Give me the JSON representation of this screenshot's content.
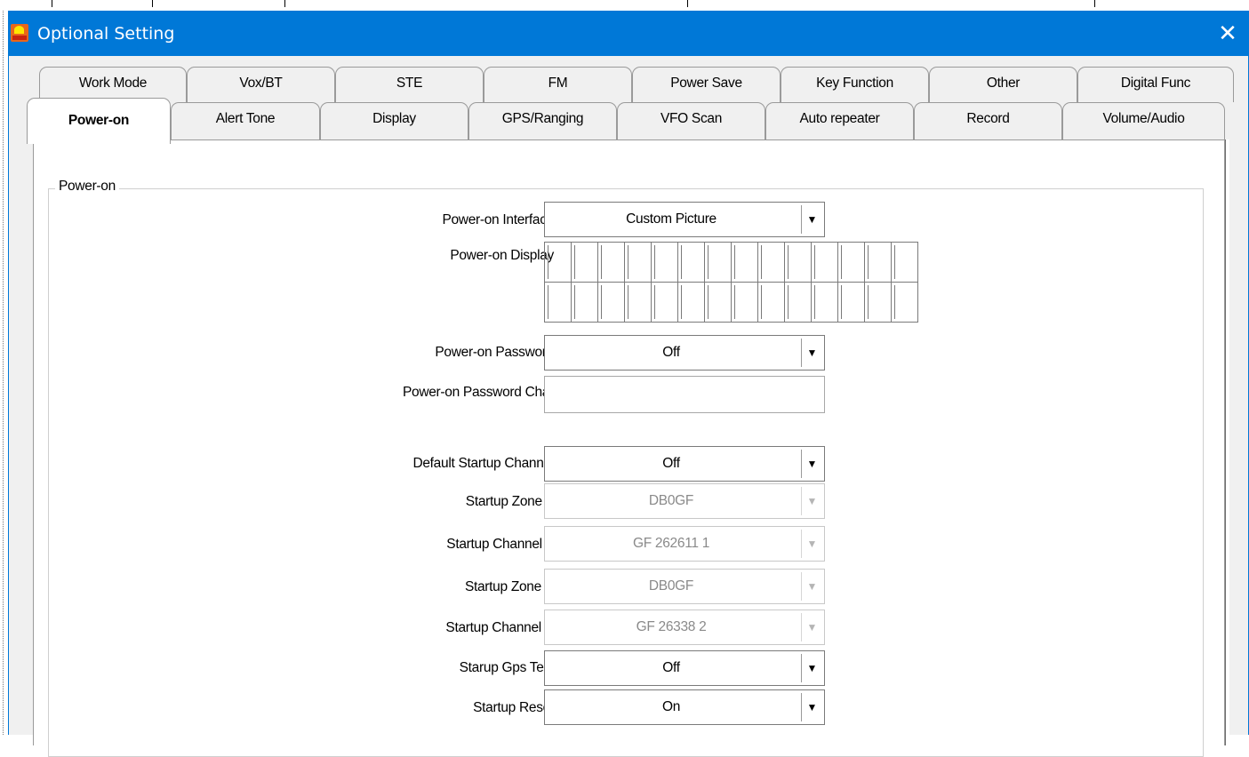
{
  "window": {
    "title": "Optional Setting",
    "close_glyph": "✕",
    "app_icon": "app-logo-icon"
  },
  "tabs": {
    "top_row": [
      "Work Mode",
      "Vox/BT",
      "STE",
      "FM",
      "Power Save",
      "Key Function",
      "Other",
      "Digital Func"
    ],
    "bottom_row": [
      "Power-on",
      "Alert Tone",
      "Display",
      "GPS/Ranging",
      "VFO Scan",
      "Auto repeater",
      "Record",
      "Volume/Audio"
    ],
    "active": "Power-on"
  },
  "group": {
    "title": "Power-on"
  },
  "fields": {
    "power_on_interface": {
      "label": "Power-on Interface",
      "value": "Custom Picture"
    },
    "power_on_display": {
      "label": "Power-on Display",
      "cells_per_row": 14,
      "rows": 2
    },
    "power_on_password": {
      "label": "Power-on Password",
      "value": "Off"
    },
    "power_on_password_char": {
      "label": "Power-on Password Char",
      "value": ""
    },
    "default_startup_channel": {
      "label": "Default Startup Channel",
      "value": "Off"
    },
    "startup_zone_a": {
      "label": "Startup Zone A",
      "value": "DB0GF",
      "enabled": false
    },
    "startup_channel_a": {
      "label": "Startup Channel A",
      "value": "GF 262611 1",
      "enabled": false
    },
    "startup_zone_b": {
      "label": "Startup Zone B",
      "value": "DB0GF",
      "enabled": false
    },
    "startup_channel_b": {
      "label": "Startup Channel B",
      "value": "GF 26338 2",
      "enabled": false
    },
    "startup_gps_test": {
      "label": "Starup Gps Test",
      "value": "Off"
    },
    "startup_reset": {
      "label": "Startup Reset",
      "value": "On"
    }
  },
  "colors": {
    "titlebar": "#0078d7",
    "dialog_bg": "#f0f0f0",
    "panel_bg": "#ffffff",
    "disabled_text": "#8a8a8a"
  }
}
